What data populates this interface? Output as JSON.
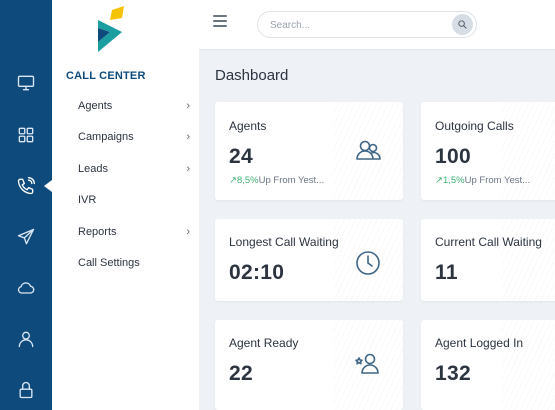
{
  "sidebar": {
    "section_title": "CALL CENTER",
    "items": [
      {
        "label": "Agents",
        "chevron": "›"
      },
      {
        "label": "Campaigns",
        "chevron": "›"
      },
      {
        "label": "Leads",
        "chevron": "›"
      },
      {
        "label": "IVR",
        "chevron": ""
      },
      {
        "label": "Reports",
        "chevron": "›"
      },
      {
        "label": "Call Settings",
        "chevron": ""
      }
    ]
  },
  "rail": {
    "icons": [
      "monitor-icon",
      "grid-icon",
      "phone-icon",
      "send-icon",
      "cloud-icon",
      "user-icon",
      "lock-icon"
    ],
    "active": "phone-icon"
  },
  "topbar": {
    "search_placeholder": "Search..."
  },
  "main": {
    "title": "Dashboard",
    "cards": [
      {
        "title": "Agents",
        "value": "24",
        "trend_pct": "8,5%",
        "trend_text": "Up From Yest...",
        "icon": "users-icon"
      },
      {
        "title": "Outgoing Calls",
        "value": "100",
        "trend_pct": "1,5%",
        "trend_text": "Up From Yest...",
        "icon": ""
      },
      {
        "title": "Longest Call Waiting",
        "value": "02:10",
        "icon": "clock-icon"
      },
      {
        "title": "Current Call Waiting",
        "value": "11",
        "icon": ""
      },
      {
        "title": "Agent Ready",
        "value": "22",
        "icon": "user-star-icon"
      },
      {
        "title": "Agent Logged In",
        "value": "132",
        "icon": ""
      }
    ]
  },
  "colors": {
    "rail_bg": "#0f4a7c",
    "accent": "#0f4a7c",
    "trend_up": "#3cb371",
    "logo_yellow": "#f5c400",
    "logo_teal": "#1a9ea0"
  }
}
